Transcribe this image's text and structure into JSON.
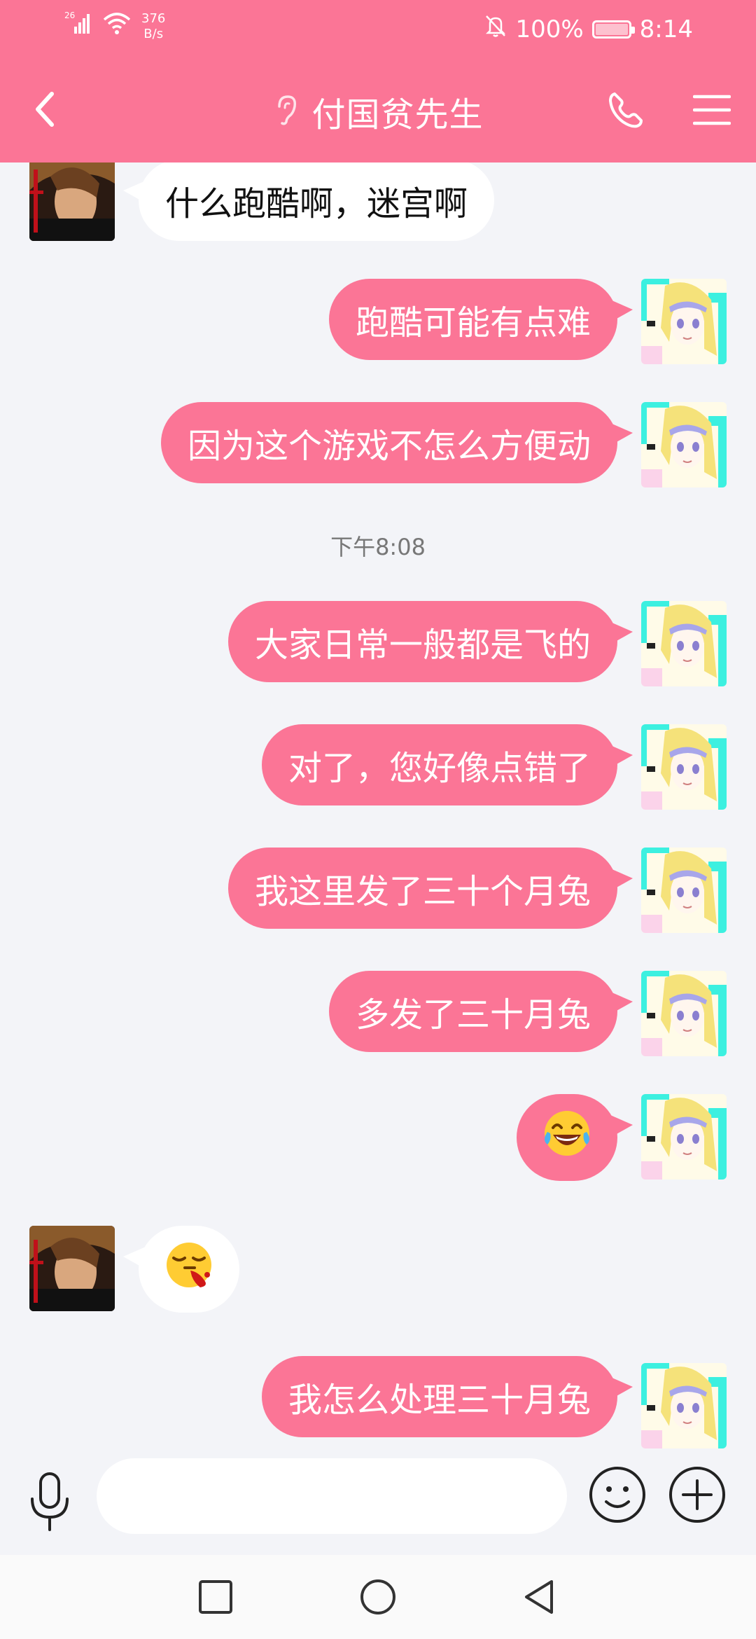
{
  "status_bar": {
    "signal_type": "26",
    "net_speed_value": "376",
    "net_speed_unit": "B/s",
    "battery": "100%",
    "time": "8:14"
  },
  "header": {
    "title": "付国贫先生",
    "earpiece_icon": "ear-icon",
    "back_icon": "chevron-left-icon",
    "call_icon": "phone-icon",
    "menu_icon": "menu-icon",
    "accent_color": "#fb7596"
  },
  "messages": [
    {
      "side": "in",
      "text": "什么跑酷啊，迷宫啊"
    },
    {
      "side": "out",
      "text": "跑酷可能有点难"
    },
    {
      "side": "out",
      "text": "因为这个游戏不怎么方便动"
    },
    {
      "side": "out",
      "text": "大家日常一般都是飞的"
    },
    {
      "side": "out",
      "text": "对了，您好像点错了"
    },
    {
      "side": "out",
      "text": "我这里发了三十个月兔"
    },
    {
      "side": "out",
      "text": "多发了三十月兔"
    },
    {
      "side": "out",
      "text": "😂"
    },
    {
      "side": "in",
      "text": "sticker"
    },
    {
      "side": "out",
      "text": "我怎么处理三十月兔"
    }
  ],
  "timestamp": "下午8:08",
  "input": {
    "value": "",
    "placeholder": "",
    "mic_icon": "microphone-icon",
    "emoji_icon": "smiley-icon",
    "plus_icon": "plus-circle-icon"
  },
  "nav": {
    "recent_icon": "square-icon",
    "home_icon": "circle-icon",
    "back_icon": "triangle-back-icon"
  }
}
